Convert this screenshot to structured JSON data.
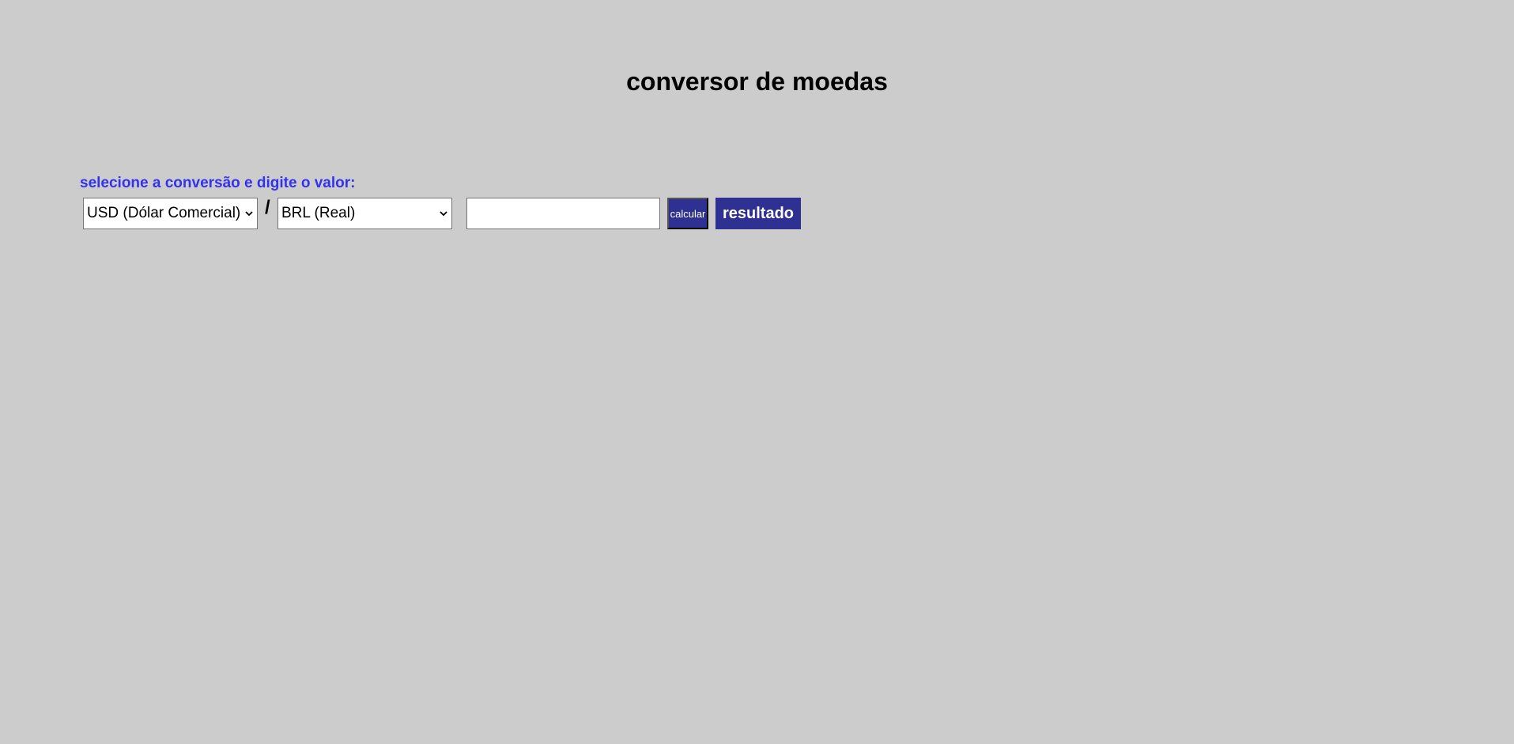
{
  "header": {
    "title": "conversor de moedas"
  },
  "form": {
    "instruction": "selecione a conversão e digite o valor:",
    "from_currency": {
      "selected": "USD (Dólar Comercial)"
    },
    "separator": "/",
    "to_currency": {
      "selected": "BRL (Real)"
    },
    "amount_input": {
      "value": "",
      "placeholder": ""
    },
    "calculate_label": "calcular",
    "result_label": "resultado"
  },
  "colors": {
    "background": "#cccccc",
    "instruction_text": "#3333ee",
    "button_bg": "#2e3192",
    "button_text": "#ffffff"
  },
  "icons": {
    "dropdown": "chevron-down-icon"
  }
}
